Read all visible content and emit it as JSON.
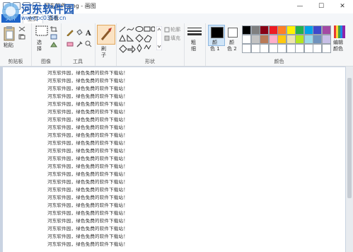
{
  "title_bar": {
    "title": "河东软件.png - 画图",
    "minimize": "—",
    "maximize": "☐",
    "close": "✕"
  },
  "watermark": {
    "brand": "河东软件园",
    "url": "www.pc0359.cn"
  },
  "menu": {
    "file": "文件",
    "home": "主页",
    "view": "查看"
  },
  "ribbon": {
    "clipboard": {
      "group_label": "剪贴板",
      "paste": "粘贴"
    },
    "image": {
      "group_label": "图像",
      "select": "选",
      "select2": "择"
    },
    "tools": {
      "group_label": "工具",
      "brush": "刷",
      "brush2": "子"
    },
    "shapes": {
      "group_label": "形状",
      "outline": "轮廓",
      "fill": "填充"
    },
    "size": {
      "label1": "粗",
      "label2": "细"
    },
    "colors": {
      "group_label": "颜色",
      "color1": "颜",
      "color1b": "色 1",
      "color2": "颜",
      "color2b": "色 2",
      "edit": "编辑",
      "edit2": "颜色",
      "swatches_row1": [
        "#000000",
        "#7f7f7f",
        "#880015",
        "#ed1c24",
        "#ff7f27",
        "#fff200",
        "#22b14c",
        "#00a2e8",
        "#3f48cc",
        "#a349a4"
      ],
      "swatches_row2": [
        "#ffffff",
        "#c3c3c3",
        "#b97a57",
        "#ffaec9",
        "#ffc90e",
        "#efe4b0",
        "#b5e61d",
        "#99d9ea",
        "#7092be",
        "#c8bfe7"
      ],
      "swatches_row3": [
        "#ffffff",
        "#ffffff",
        "#ffffff",
        "#ffffff",
        "#ffffff",
        "#ffffff",
        "#ffffff",
        "#ffffff",
        "#ffffff",
        "#ffffff"
      ]
    }
  },
  "document": {
    "lines": [
      "河东软件园，绿色免费的软件下载站！",
      "河东软件园，绿色免费的软件下载站！",
      "河东软件园，绿色免费的软件下载站！",
      "河东软件园，绿色免费的软件下载站！",
      "河东软件园，绿色免费的软件下载站！",
      "河东软件园，绿色免费的软件下载站！",
      "河东软件园，绿色免费的软件下载站！",
      "河东软件园，绿色免费的软件下载站！",
      "河东软件园，绿色免费的软件下载站！",
      "河东软件园，绿色免费的软件下载站！",
      "河东软件园，绿色免费的软件下载站！",
      "河东软件园，绿色免费的软件下载站！",
      "河东软件园，绿色免费的软件下载站！",
      "河东软件园，绿色免费的软件下载站！",
      "河东软件园，绿色免费的软件下载站！",
      "河东软件园，绿色免费的软件下载站！",
      "河东软件园，绿色免费的软件下载站！",
      "河东软件园，绿色免费的软件下载站！",
      "河东软件园，绿色免费的软件下载站！",
      "河东软件园，绿色免费的软件下载站！",
      "河东软件园，绿色免费的软件下载站！",
      "河东软件园，绿色免费的软件下载站！",
      "河东软件园，绿色免费的软件下载站！"
    ]
  }
}
